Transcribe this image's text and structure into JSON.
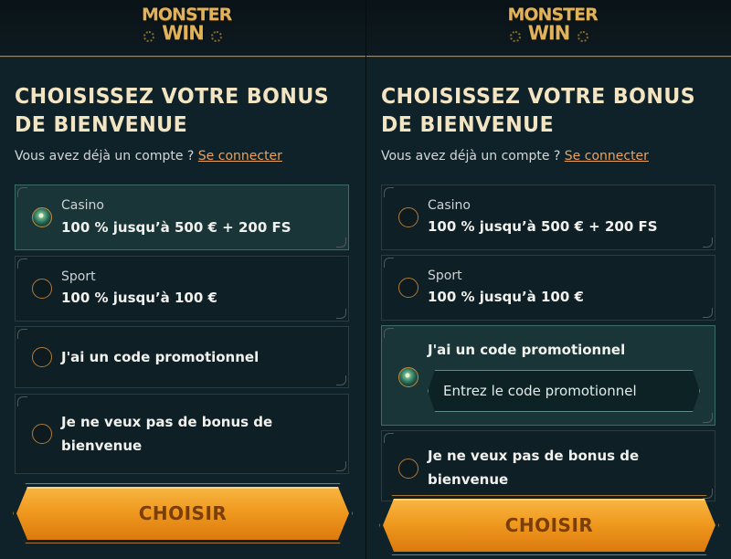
{
  "brand": {
    "line1": "MONSTER",
    "line2": "WIN"
  },
  "left": {
    "title": "CHOISISSEZ VOTRE BONUS DE BIENVENUE",
    "login_prompt": "Vous avez déjà un compte ?",
    "login_link": "Se connecter",
    "options": [
      {
        "label": "Casino",
        "value": "100 % jusqu’à 500 € + 200 FS",
        "selected": true
      },
      {
        "label": "Sport",
        "value": "100 % jusqu’à 100 €",
        "selected": false
      },
      {
        "label": "J'ai un code promotionnel",
        "selected": false
      },
      {
        "label": "Je ne veux pas de bonus de bienvenue",
        "selected": false
      }
    ],
    "button": "CHOISIR"
  },
  "right": {
    "title": "CHOISISSEZ VOTRE BONUS DE BIENVENUE",
    "login_prompt": "Vous avez déjà un compte ?",
    "login_link": "Se connecter",
    "options": [
      {
        "label": "Casino",
        "value": "100 % jusqu’à 500 € + 200 FS",
        "selected": false
      },
      {
        "label": "Sport",
        "value": "100 % jusqu’à 100 €",
        "selected": false
      },
      {
        "label": "J'ai un code promotionnel",
        "selected": true,
        "input_placeholder": "Entrez le code promotionnel"
      },
      {
        "label": "Je ne veux pas de bonus de bienvenue",
        "selected": false
      }
    ],
    "button": "CHOISIR"
  },
  "colors": {
    "accent": "#f09a20",
    "link": "#e9a35c",
    "selected_bg": "#1a3537",
    "title": "#f3e4c2"
  }
}
